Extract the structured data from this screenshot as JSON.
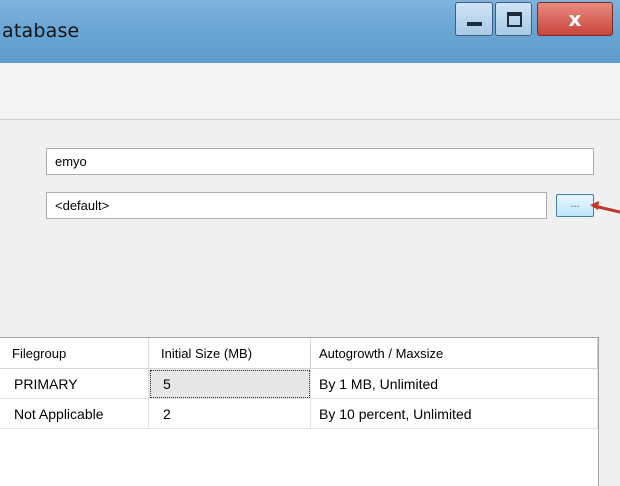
{
  "window": {
    "title": "atabase",
    "minimize_icon": "minimize-icon",
    "maximize_icon": "maximize-icon",
    "close_glyph": "x"
  },
  "general": {
    "database_name": "emyo",
    "owner": "<default>",
    "browse_label": "..."
  },
  "files_grid": {
    "columns": [
      "Filegroup",
      "Initial Size (MB)",
      "Autogrowth / Maxsize"
    ],
    "rows": [
      {
        "filegroup": "PRIMARY",
        "initial_size": "5",
        "autogrowth": "By 1 MB, Unlimited"
      },
      {
        "filegroup": "Not Applicable",
        "initial_size": "2",
        "autogrowth": "By 10 percent, Unlimited"
      }
    ]
  },
  "annotation": {
    "arrow_color": "#c0392b"
  }
}
